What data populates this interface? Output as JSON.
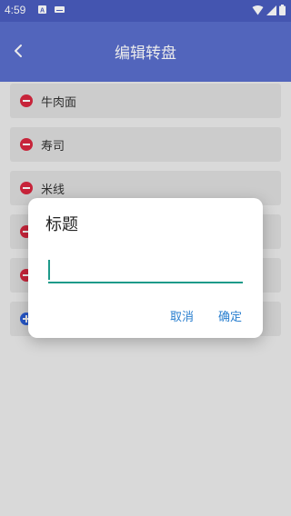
{
  "status_bar": {
    "time": "4:59",
    "icons": [
      "a-notification-icon",
      "keyboard-notification-icon",
      "wifi-icon",
      "signal-icon",
      "battery-icon"
    ]
  },
  "app_bar": {
    "title": "编辑转盘",
    "back_icon": "chevron-left-icon"
  },
  "list": {
    "items": [
      {
        "label": "牛肉面",
        "icon": "remove-icon"
      },
      {
        "label": "寿司",
        "icon": "remove-icon"
      },
      {
        "label": "米线",
        "icon": "remove-icon"
      },
      {
        "label": "",
        "icon": "remove-icon"
      },
      {
        "label": "",
        "icon": "remove-icon"
      },
      {
        "label": "",
        "icon": "add-icon"
      }
    ]
  },
  "dialog": {
    "title": "标题",
    "input_value": "",
    "cancel_label": "取消",
    "ok_label": "确定"
  },
  "colors": {
    "status_bar": "#4a5dbf",
    "app_bar": "#5a6ecc",
    "remove": "#d8283f",
    "add": "#2b5fd8",
    "accent": "#1e9a8a",
    "button_text": "#2a7fcf"
  }
}
